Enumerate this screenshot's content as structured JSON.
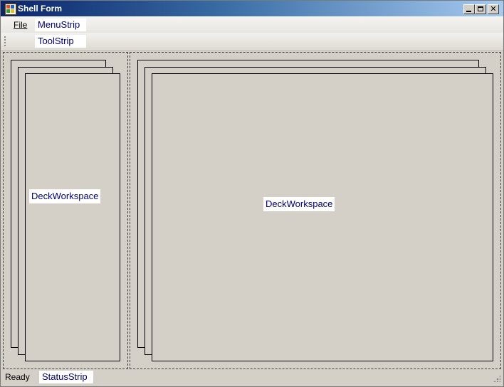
{
  "window": {
    "title": "Shell Form"
  },
  "menustrip": {
    "file_label": "File",
    "type_here": "MenuStrip"
  },
  "toolstrip": {
    "type_here": "ToolStrip"
  },
  "workspaces": {
    "left_label": "DeckWorkspace",
    "right_label": "DeckWorkspace"
  },
  "statusstrip": {
    "ready_label": "Ready",
    "type_here": "StatusStrip"
  },
  "colors": {
    "titlebar_start": "#0a246a",
    "titlebar_end": "#a6caf0",
    "type_here_text": "#000080",
    "form_background": "#d4d0c8"
  },
  "icons": {
    "app": "app-icon",
    "minimize": "minimize-icon",
    "maximize": "maximize-icon",
    "close": "close-icon",
    "grip": "toolstrip-grip-icon",
    "size_grip": "size-grip-icon"
  }
}
